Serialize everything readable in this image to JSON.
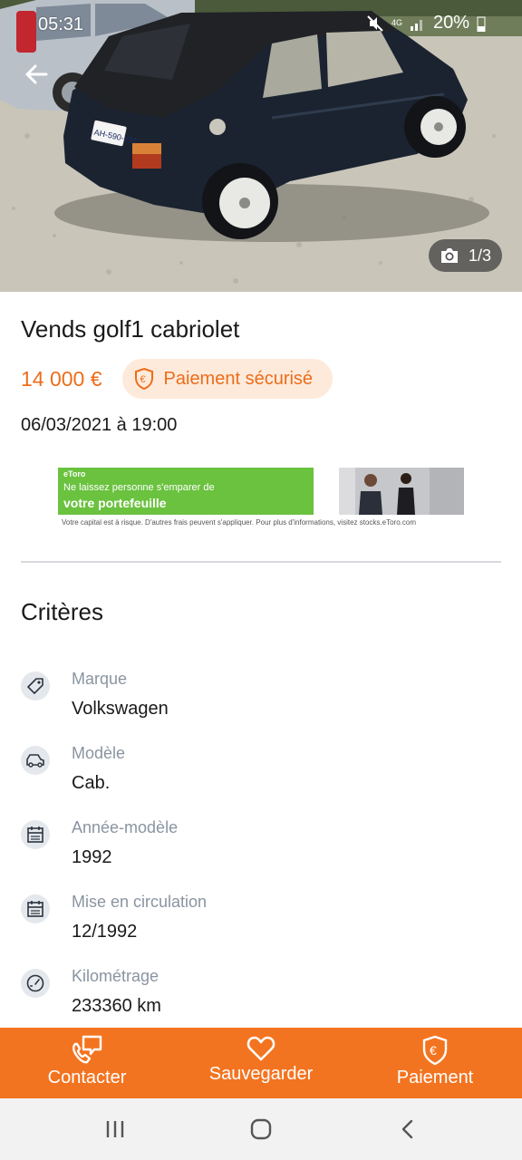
{
  "status_bar": {
    "time": "05:31",
    "network": "4G",
    "battery": "20%"
  },
  "photo": {
    "counter": "1/3",
    "plate": "AH-590-YM"
  },
  "listing": {
    "title": "Vends golf1 cabriolet",
    "price": "14 000 €",
    "secure_payment_label": "Paiement sécurisé",
    "date": "06/03/2021 à 19:00"
  },
  "ad": {
    "brand": "eToro",
    "line1": "Ne laissez personne  s'emparer de",
    "line2": "votre portefeuille",
    "disclaimer": "Votre capital est à risque. D'autres frais peuvent s'appliquer. Pour plus d'informations, visitez stocks.eToro.com"
  },
  "criteria": {
    "title": "Critères",
    "items": [
      {
        "label": "Marque",
        "value": "Volkswagen",
        "icon": "tag-icon"
      },
      {
        "label": "Modèle",
        "value": "Cab.",
        "icon": "car-icon"
      },
      {
        "label": "Année-modèle",
        "value": "1992",
        "icon": "calendar-icon"
      },
      {
        "label": "Mise en circulation",
        "value": "12/1992",
        "icon": "calendar-icon"
      },
      {
        "label": "Kilométrage",
        "value": "233360 km",
        "icon": "speedometer-icon"
      }
    ]
  },
  "actions": {
    "contact": "Contacter",
    "save": "Sauvegarder",
    "payment": "Paiement"
  },
  "colors": {
    "accent": "#f37420",
    "price": "#ec6d1a",
    "pill_bg": "#fdeadb",
    "muted": "#8a94a0"
  }
}
